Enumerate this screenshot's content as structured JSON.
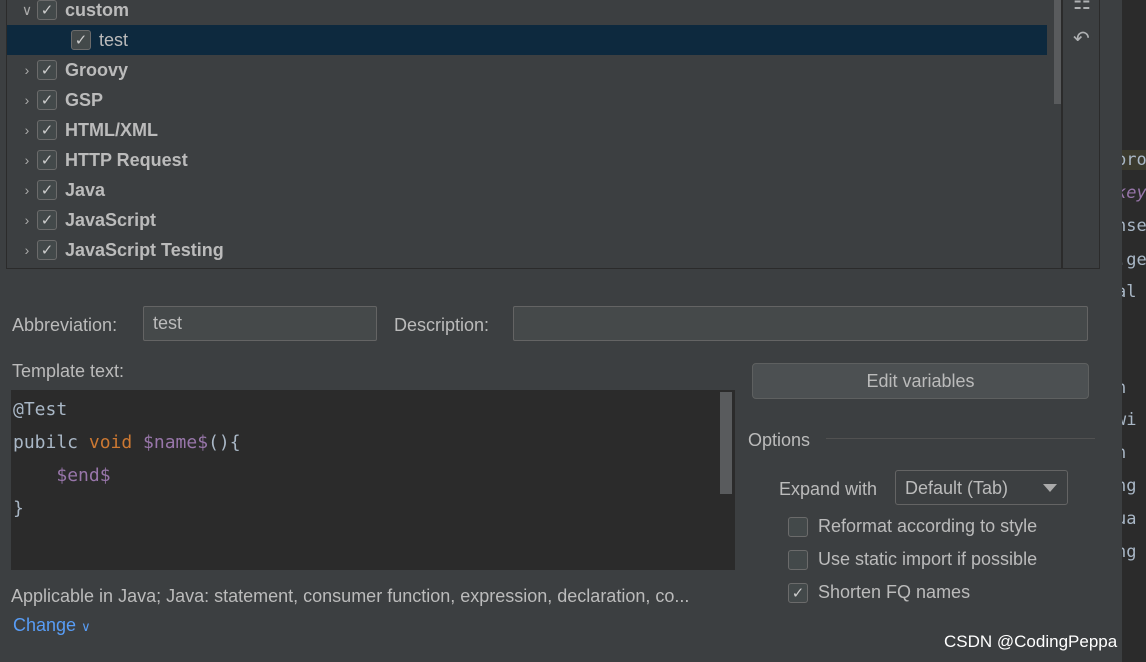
{
  "tree": {
    "rows": [
      {
        "label": "custom",
        "expanded": true,
        "checked": true,
        "group": true
      },
      {
        "label": "test",
        "checked": true,
        "group": false,
        "selected": true
      },
      {
        "label": "Groovy",
        "expanded": false,
        "checked": true,
        "group": true
      },
      {
        "label": "GSP",
        "expanded": false,
        "checked": true,
        "group": true
      },
      {
        "label": "HTML/XML",
        "expanded": false,
        "checked": true,
        "group": true
      },
      {
        "label": "HTTP Request",
        "expanded": false,
        "checked": true,
        "group": true
      },
      {
        "label": "Java",
        "expanded": false,
        "checked": true,
        "group": true
      },
      {
        "label": "JavaScript",
        "expanded": false,
        "checked": true,
        "group": true
      },
      {
        "label": "JavaScript Testing",
        "expanded": false,
        "checked": true,
        "group": true
      }
    ]
  },
  "sidebar": {
    "icons": [
      "copy-icon",
      "undo-icon"
    ]
  },
  "form": {
    "abbreviation_label": "Abbreviation:",
    "abbreviation_value": "test",
    "description_label": "Description:",
    "description_value": "",
    "template_text_label": "Template text:",
    "code": {
      "line1": "@Test",
      "line2_a": "pubilc ",
      "line2_kw": "void ",
      "line2_var": "$name$",
      "line2_b": "(){",
      "line3_indent": "    ",
      "line3_var": "$end$",
      "line4": "}"
    },
    "applicable": "Applicable in Java; Java: statement, consumer function, expression, declaration, co...",
    "change_link": "Change"
  },
  "options": {
    "edit_variables": "Edit variables",
    "title": "Options",
    "expand_with_label": "Expand with",
    "expand_with_value": "Default (Tab)",
    "checkboxes": [
      {
        "label": "Reformat according to style",
        "checked": false
      },
      {
        "label": "Use static import if possible",
        "checked": false
      },
      {
        "label": "Shorten FQ names",
        "checked": true
      }
    ]
  },
  "background_editor": [
    "pro",
    "key",
    "nse",
    ".ge",
    "al f",
    "n",
    "wi",
    "n",
    "ng",
    "ua",
    "ng"
  ],
  "watermark": "CSDN @CodingPeppa",
  "colors": {
    "selection": "#0d293e",
    "keyword": "#cc7832",
    "variable": "#9876aa",
    "link": "#589df6"
  }
}
